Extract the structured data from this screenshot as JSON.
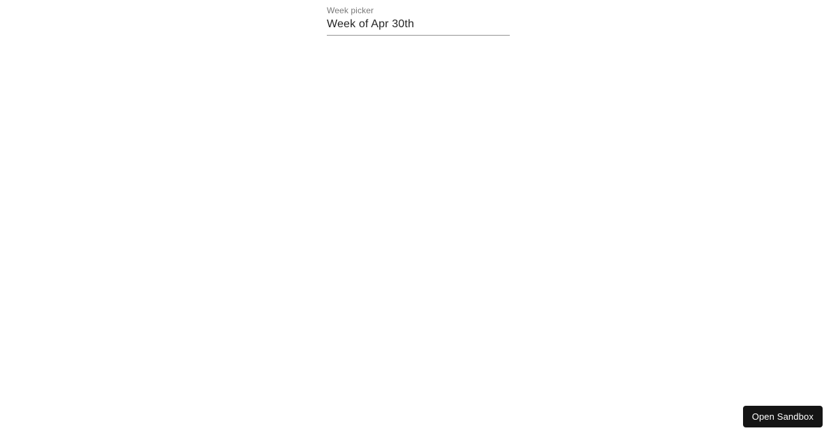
{
  "picker": {
    "label": "Week picker",
    "value": "Week of Apr 30th"
  },
  "sandbox": {
    "button_label": "Open Sandbox"
  }
}
